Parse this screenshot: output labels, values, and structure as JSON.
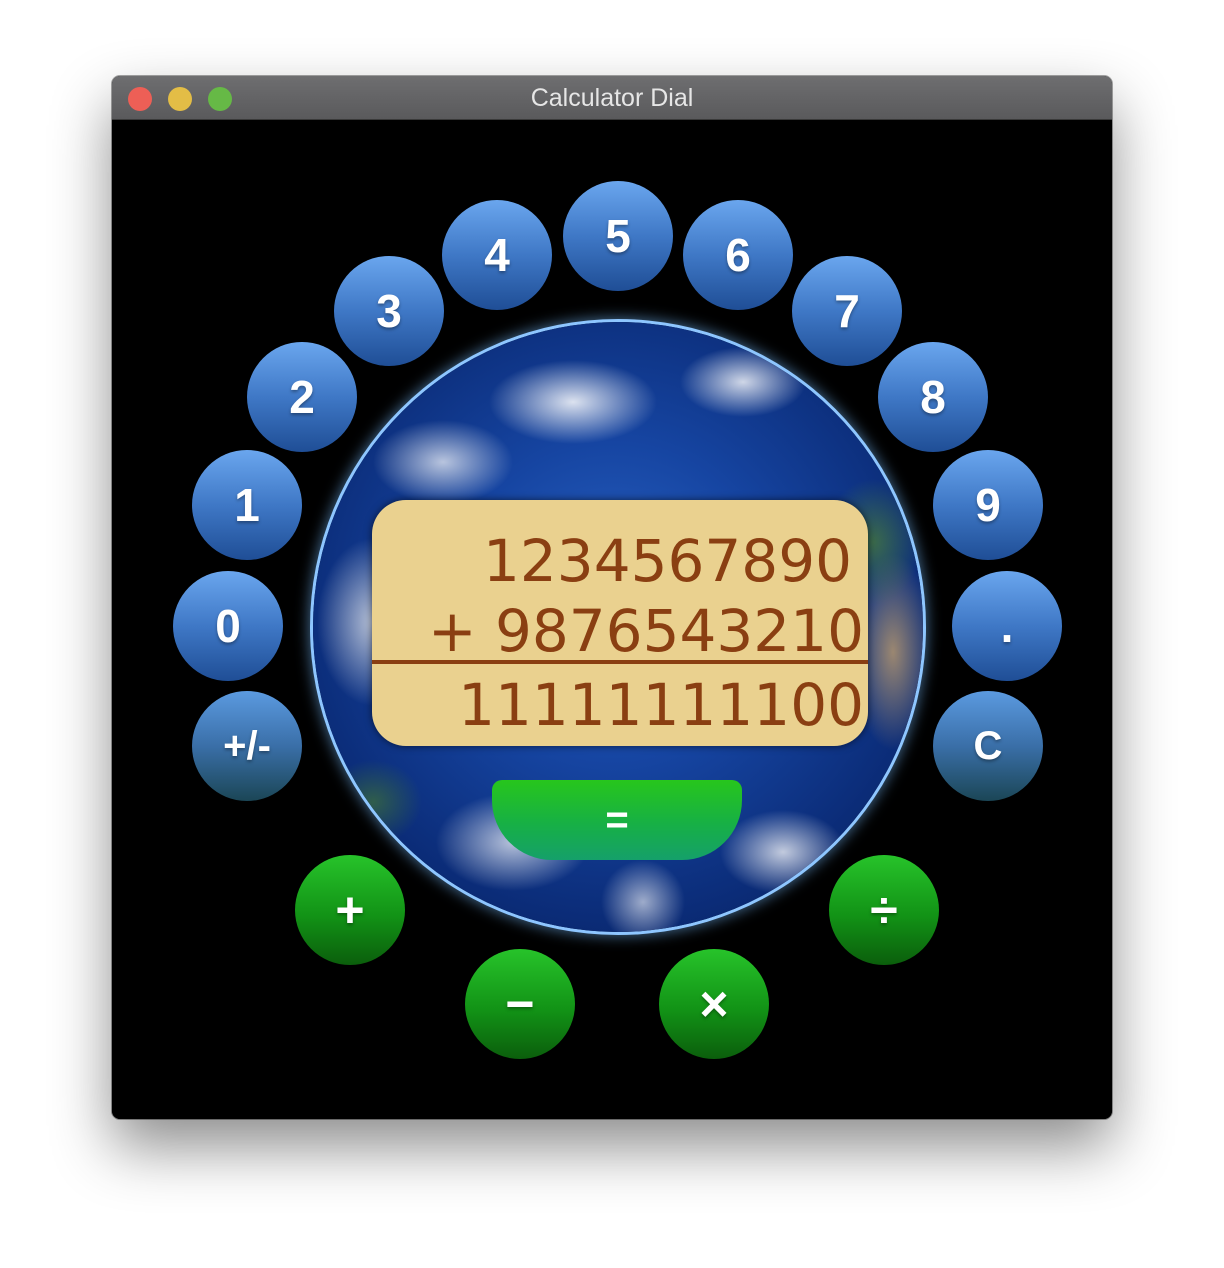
{
  "window": {
    "title": "Calculator Dial"
  },
  "display": {
    "operand1": "1234567890",
    "operation_line": "+ 9876543210",
    "result": "11111111100"
  },
  "digits": {
    "d0": "0",
    "d1": "1",
    "d2": "2",
    "d3": "3",
    "d4": "4",
    "d5": "5",
    "d6": "6",
    "d7": "7",
    "d8": "8",
    "d9": "9",
    "dot": "."
  },
  "controls": {
    "negate": "+/-",
    "clear": "C",
    "equals": "="
  },
  "operators": {
    "add": "+",
    "subtract": "−",
    "multiply": "×",
    "divide": "÷"
  },
  "colors": {
    "digit_button": "#3f78c6",
    "operator_button": "#129316",
    "display_bg": "#ead18f",
    "display_text": "#8a3f12"
  }
}
